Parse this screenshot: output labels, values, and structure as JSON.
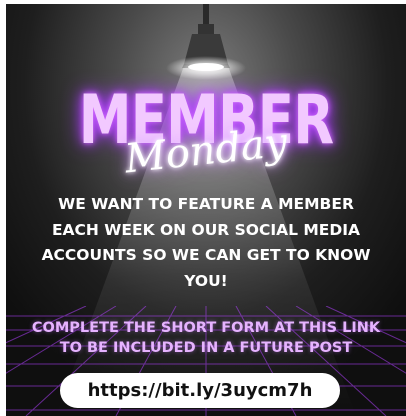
{
  "poster": {
    "title": "MEMBER",
    "subtitle": "Monday",
    "intro": "WE WANT TO FEATURE A MEMBER EACH WEEK ON OUR SOCIAL MEDIA ACCOUNTS SO WE CAN GET TO KNOW YOU!",
    "cta": "COMPLETE THE SHORT FORM AT THIS LINK TO BE INCLUDED IN A FUTURE POST",
    "link": "https://bit.ly/3uycm7h"
  },
  "colors": {
    "neon_purple": "#b040ff",
    "title_fill": "#f2c9ff",
    "cta_text": "#e6b3ff",
    "background": "#1e1e1e",
    "pill": "#ffffff"
  },
  "icons": [
    "ceiling-lamp-icon",
    "neon-grid-floor"
  ]
}
